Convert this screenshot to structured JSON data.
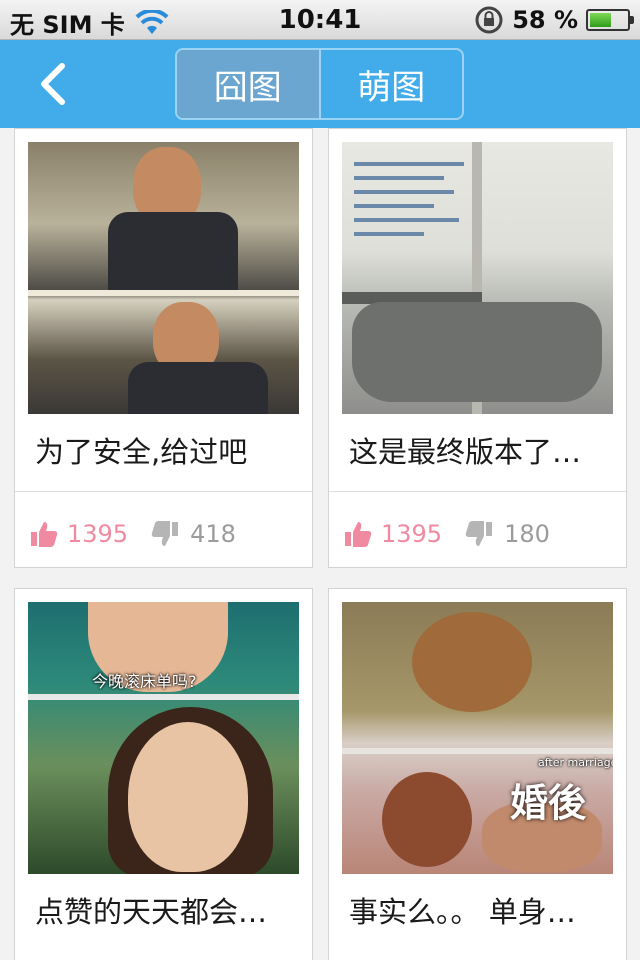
{
  "status_bar": {
    "carrier": "无 SIM 卡",
    "time": "10:41",
    "battery": "58 %",
    "battery_level": 0.58
  },
  "nav": {
    "back_icon": "chevron-left-icon",
    "tabs": [
      {
        "label": "囧图",
        "active": true
      },
      {
        "label": "萌图",
        "active": false
      }
    ]
  },
  "cards": [
    {
      "title": "为了安全,给过吧",
      "likes": "1395",
      "dislikes": "418"
    },
    {
      "title": "这是最终版本了…",
      "likes": "1395",
      "dislikes": "180"
    },
    {
      "title": "点赞的天天都会…",
      "overlay": "今晚滚床单吗?"
    },
    {
      "title": "事实么。。 单身…",
      "overlay": "婚後",
      "overlay_small": "after marriage"
    }
  ],
  "colors": {
    "nav_bg": "#41ace9",
    "like": "#f08aa0",
    "dislike": "#9b9b9b"
  }
}
